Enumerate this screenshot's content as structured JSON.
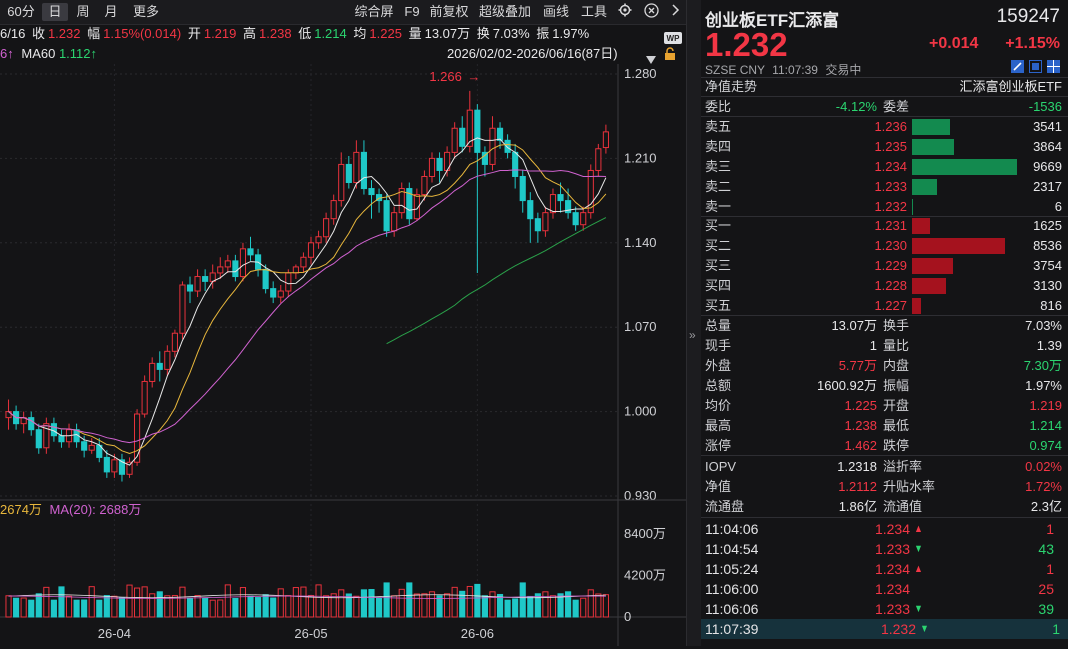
{
  "toolbar": {
    "period": "60分",
    "tabs": [
      "日",
      "周",
      "月",
      "更多"
    ],
    "active_tab": "日",
    "right_items": [
      "综合屏",
      "F9",
      "前复权",
      "超级叠加",
      "画线",
      "工具"
    ]
  },
  "quote_line": {
    "date": "6/16",
    "close_label": "收",
    "close": "1.232",
    "change_label": "幅",
    "change": "1.15%(0.014)",
    "open_label": "开",
    "open": "1.219",
    "high_label": "高",
    "high": "1.238",
    "low_label": "低",
    "low": "1.214",
    "avg_label": "均",
    "avg": "1.225",
    "vol_label": "量",
    "vol": "13.07万",
    "turnover_label": "换",
    "turnover": "7.03%",
    "amplitude_label": "振",
    "amplitude": "1.97%"
  },
  "ma_line": {
    "ma_prefix": "6↑",
    "ma60_label": "MA60",
    "ma60_value": "1.112↑",
    "date_range": "2026/02/02-2026/06/16(87日)"
  },
  "volume_line": {
    "vol": "2674万",
    "ma20_label": "MA(20):",
    "ma20": "2688万"
  },
  "chart_data": {
    "type": "candlestick",
    "price_ticks": [
      "1.280",
      "1.210",
      "1.140",
      "1.070",
      "1.000",
      "0.930"
    ],
    "price_range": [
      0.93,
      1.28
    ],
    "volume_ticks": [
      "8400万",
      "4200万",
      "0"
    ],
    "volume_range": [
      0,
      8400
    ],
    "x_ticks": [
      {
        "label": "26-04",
        "index": 14
      },
      {
        "label": "26-05",
        "index": 40
      },
      {
        "label": "26-06",
        "index": 62
      }
    ],
    "high_annotation": {
      "label": "1.266",
      "index": 62
    },
    "candles": [
      [
        0.995,
        1.0,
        1.01,
        0.985
      ],
      [
        1.0,
        0.99,
        1.005,
        0.985
      ],
      [
        0.99,
        0.995,
        1.0,
        0.982
      ],
      [
        0.995,
        0.985,
        1.0,
        0.98
      ],
      [
        0.985,
        0.97,
        0.99,
        0.965
      ],
      [
        0.97,
        0.99,
        0.995,
        0.965
      ],
      [
        0.99,
        0.98,
        0.995,
        0.975
      ],
      [
        0.98,
        0.975,
        0.985,
        0.97
      ],
      [
        0.975,
        0.985,
        0.99,
        0.97
      ],
      [
        0.985,
        0.975,
        0.99,
        0.97
      ],
      [
        0.975,
        0.968,
        0.98,
        0.962
      ],
      [
        0.968,
        0.972,
        0.978,
        0.965
      ],
      [
        0.972,
        0.962,
        0.978,
        0.958
      ],
      [
        0.962,
        0.95,
        0.968,
        0.945
      ],
      [
        0.95,
        0.96,
        0.965,
        0.945
      ],
      [
        0.96,
        0.948,
        0.965,
        0.942
      ],
      [
        0.948,
        0.958,
        0.962,
        0.945
      ],
      [
        0.958,
        0.998,
        1.002,
        0.955
      ],
      [
        0.998,
        1.025,
        1.03,
        0.995
      ],
      [
        1.025,
        1.04,
        1.045,
        1.02
      ],
      [
        1.04,
        1.035,
        1.05,
        1.025
      ],
      [
        1.035,
        1.05,
        1.055,
        1.03
      ],
      [
        1.05,
        1.065,
        1.068,
        1.045
      ],
      [
        1.065,
        1.105,
        1.108,
        1.06
      ],
      [
        1.105,
        1.1,
        1.112,
        1.09
      ],
      [
        1.1,
        1.112,
        1.118,
        1.095
      ],
      [
        1.112,
        1.108,
        1.118,
        1.1
      ],
      [
        1.108,
        1.115,
        1.122,
        1.102
      ],
      [
        1.115,
        1.12,
        1.128,
        1.11
      ],
      [
        1.12,
        1.125,
        1.13,
        1.115
      ],
      [
        1.125,
        1.112,
        1.13,
        1.108
      ],
      [
        1.112,
        1.135,
        1.14,
        1.108
      ],
      [
        1.135,
        1.13,
        1.145,
        1.125
      ],
      [
        1.13,
        1.118,
        1.135,
        1.112
      ],
      [
        1.118,
        1.102,
        1.122,
        1.098
      ],
      [
        1.102,
        1.095,
        1.108,
        1.09
      ],
      [
        1.095,
        1.1,
        1.105,
        1.09
      ],
      [
        1.1,
        1.115,
        1.118,
        1.095
      ],
      [
        1.115,
        1.12,
        1.122,
        1.11
      ],
      [
        1.12,
        1.128,
        1.132,
        1.115
      ],
      [
        1.128,
        1.14,
        1.145,
        1.122
      ],
      [
        1.14,
        1.145,
        1.15,
        1.135
      ],
      [
        1.145,
        1.16,
        1.165,
        1.14
      ],
      [
        1.16,
        1.175,
        1.18,
        1.155
      ],
      [
        1.175,
        1.205,
        1.215,
        1.17
      ],
      [
        1.205,
        1.19,
        1.212,
        1.185
      ],
      [
        1.19,
        1.215,
        1.225,
        1.185
      ],
      [
        1.215,
        1.185,
        1.225,
        1.18
      ],
      [
        1.185,
        1.18,
        1.192,
        1.16
      ],
      [
        1.18,
        1.175,
        1.185,
        1.165
      ],
      [
        1.175,
        1.15,
        1.18,
        1.145
      ],
      [
        1.15,
        1.165,
        1.17,
        1.145
      ],
      [
        1.165,
        1.185,
        1.19,
        1.16
      ],
      [
        1.185,
        1.16,
        1.19,
        1.155
      ],
      [
        1.16,
        1.18,
        1.185,
        1.158
      ],
      [
        1.18,
        1.195,
        1.2,
        1.175
      ],
      [
        1.195,
        1.21,
        1.215,
        1.19
      ],
      [
        1.21,
        1.2,
        1.215,
        1.19
      ],
      [
        1.2,
        1.215,
        1.22,
        1.195
      ],
      [
        1.215,
        1.235,
        1.24,
        1.21
      ],
      [
        1.235,
        1.22,
        1.245,
        1.215
      ],
      [
        1.22,
        1.25,
        1.266,
        1.215
      ],
      [
        1.25,
        1.215,
        1.255,
        1.115
      ],
      [
        1.215,
        1.205,
        1.22,
        1.195
      ],
      [
        1.205,
        1.235,
        1.245,
        1.2
      ],
      [
        1.235,
        1.225,
        1.24,
        1.218
      ],
      [
        1.225,
        1.215,
        1.23,
        1.21
      ],
      [
        1.215,
        1.195,
        1.222,
        1.185
      ],
      [
        1.195,
        1.175,
        1.2,
        1.165
      ],
      [
        1.175,
        1.16,
        1.182,
        1.14
      ],
      [
        1.16,
        1.15,
        1.165,
        1.14
      ],
      [
        1.15,
        1.165,
        1.17,
        1.145
      ],
      [
        1.165,
        1.18,
        1.185,
        1.16
      ],
      [
        1.18,
        1.175,
        1.19,
        1.165
      ],
      [
        1.175,
        1.165,
        1.185,
        1.16
      ],
      [
        1.165,
        1.155,
        1.17,
        1.15
      ],
      [
        1.155,
        1.165,
        1.17,
        1.15
      ],
      [
        1.165,
        1.2,
        1.205,
        1.16
      ],
      [
        1.2,
        1.218,
        1.222,
        1.195
      ],
      [
        1.219,
        1.232,
        1.238,
        1.214
      ]
    ]
  },
  "header": {
    "name": "创业板ETF汇添富",
    "code": "159247",
    "price": "1.232",
    "change": "+0.014",
    "change_pct": "+1.15%",
    "exchange": "SZSE",
    "currency": "CNY",
    "time": "11:07:39",
    "status": "交易中"
  },
  "nav_section": {
    "title": "净值走势",
    "fund_name": "汇添富创业板ETF"
  },
  "order_ratio": {
    "wb_label": "委比",
    "wb": "-4.12%",
    "wc_label": "委差",
    "wc": "-1536"
  },
  "asks": [
    {
      "label": "卖五",
      "price": "1.236",
      "volume": "3541",
      "vol": 3541
    },
    {
      "label": "卖四",
      "price": "1.235",
      "volume": "3864",
      "vol": 3864
    },
    {
      "label": "卖三",
      "price": "1.234",
      "volume": "9669",
      "vol": 9669
    },
    {
      "label": "卖二",
      "price": "1.233",
      "volume": "2317",
      "vol": 2317
    },
    {
      "label": "卖一",
      "price": "1.232",
      "volume": "6",
      "vol": 6
    }
  ],
  "bids": [
    {
      "label": "买一",
      "price": "1.231",
      "volume": "1625",
      "vol": 1625
    },
    {
      "label": "买二",
      "price": "1.230",
      "volume": "8536",
      "vol": 8536
    },
    {
      "label": "买三",
      "price": "1.229",
      "volume": "3754",
      "vol": 3754
    },
    {
      "label": "买四",
      "price": "1.228",
      "volume": "3130",
      "vol": 3130
    },
    {
      "label": "买五",
      "price": "1.227",
      "volume": "816",
      "vol": 816
    }
  ],
  "stats": [
    {
      "l1": "总量",
      "v1": "13.07万",
      "c1": "white",
      "l2": "换手",
      "v2": "7.03%",
      "c2": "white"
    },
    {
      "l1": "现手",
      "v1": "1",
      "c1": "white",
      "l2": "量比",
      "v2": "1.39",
      "c2": "white"
    },
    {
      "l1": "外盘",
      "v1": "5.77万",
      "c1": "red",
      "l2": "内盘",
      "v2": "7.30万",
      "c2": "green"
    },
    {
      "l1": "总额",
      "v1": "1600.92万",
      "c1": "white",
      "l2": "振幅",
      "v2": "1.97%",
      "c2": "white"
    },
    {
      "l1": "均价",
      "v1": "1.225",
      "c1": "red",
      "l2": "开盘",
      "v2": "1.219",
      "c2": "red"
    },
    {
      "l1": "最高",
      "v1": "1.238",
      "c1": "red",
      "l2": "最低",
      "v2": "1.214",
      "c2": "green"
    },
    {
      "l1": "涨停",
      "v1": "1.462",
      "c1": "red",
      "l2": "跌停",
      "v2": "0.974",
      "c2": "green"
    }
  ],
  "stats2": [
    {
      "l1": "IOPV",
      "v1": "1.2318",
      "c1": "white",
      "l2": "溢折率",
      "v2": "0.02%",
      "c2": "red"
    },
    {
      "l1": "净值",
      "v1": "1.2112",
      "c1": "red",
      "l2": "升贴水率",
      "v2": "1.72%",
      "c2": "red"
    },
    {
      "l1": "流通盘",
      "v1": "1.86亿",
      "c1": "white",
      "l2": "流通值",
      "v2": "2.3亿",
      "c2": "white"
    }
  ],
  "ticks": [
    {
      "time": "11:04:06",
      "price": "1.234",
      "dir": "up",
      "vol": "1",
      "vc": "red"
    },
    {
      "time": "11:04:54",
      "price": "1.233",
      "dir": "down",
      "vol": "43",
      "vc": "green"
    },
    {
      "time": "11:05:24",
      "price": "1.234",
      "dir": "up",
      "vol": "1",
      "vc": "red"
    },
    {
      "time": "11:06:00",
      "price": "1.234",
      "dir": "",
      "vol": "25",
      "vc": "red"
    },
    {
      "time": "11:06:06",
      "price": "1.233",
      "dir": "down",
      "vol": "39",
      "vc": "green"
    },
    {
      "time": "11:07:39",
      "price": "1.232",
      "dir": "down",
      "vol": "1",
      "vc": "green"
    }
  ],
  "colors": {
    "up": "#f23645",
    "down": "#2bd470",
    "candle_up": "#e8323c",
    "candle_down": "#1fc8c8",
    "ma5": "#e8e8e8",
    "ma10": "#e8b73c",
    "ma20": "#d062d0",
    "ma60": "#2aa14a",
    "ask_bar": "#138a4f",
    "bid_bar": "#a5121e"
  }
}
